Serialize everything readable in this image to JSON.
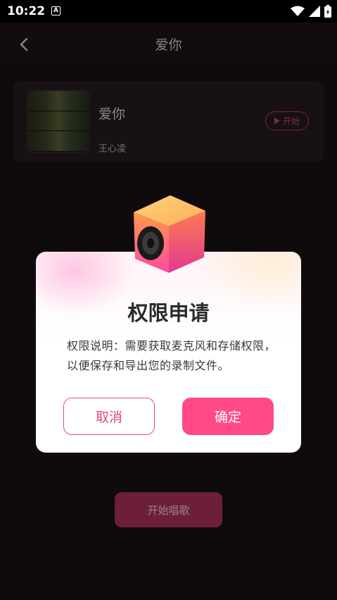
{
  "status_bar": {
    "time": "10:22",
    "notification_icon": "A"
  },
  "app_bar": {
    "title": "爱你"
  },
  "song_card": {
    "title": "爱你",
    "artist": "王心凌",
    "start_label": "开始"
  },
  "main": {
    "start_singing_label": "开始唱歌"
  },
  "dialog": {
    "title": "权限申请",
    "message": "权限说明：需要获取麦克风和存储权限，以便保存和导出您的录制文件。",
    "cancel_label": "取消",
    "confirm_label": "确定"
  },
  "colors": {
    "accent": "#ff4a86",
    "background": "#171012"
  }
}
